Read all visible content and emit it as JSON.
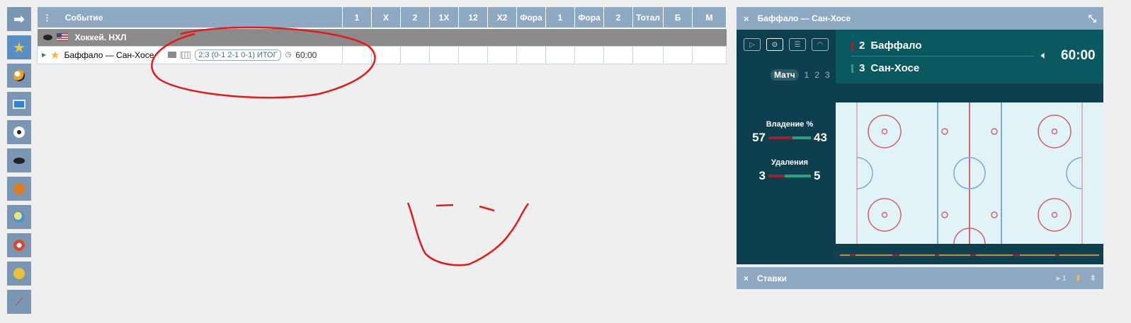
{
  "sidebar": {
    "items": [
      {
        "icon": "arrow-right-icon",
        "active": false
      },
      {
        "icon": "star-icon",
        "active": true
      },
      {
        "icon": "multi-sport-icon",
        "active": false
      },
      {
        "icon": "monitor-icon",
        "active": false
      },
      {
        "icon": "soccer-ball-icon",
        "active": false
      },
      {
        "icon": "hockey-puck-icon",
        "active": false
      },
      {
        "icon": "basketball-icon",
        "active": false
      },
      {
        "icon": "volleyball-icon",
        "active": false
      },
      {
        "icon": "handball-icon",
        "active": false
      },
      {
        "icon": "tennis-ball-icon",
        "active": false
      },
      {
        "icon": "badminton-icon",
        "active": false
      }
    ]
  },
  "events": {
    "header": {
      "menu": "⋮",
      "event": "Событие",
      "columns": [
        "1",
        "X",
        "2",
        "1X",
        "12",
        "X2",
        "Фора",
        "1",
        "Фора",
        "2",
        "Тотал",
        "Б",
        "М"
      ]
    },
    "league": {
      "name": "Хоккей. НХЛ"
    },
    "match": {
      "teams": "Баффало — Сан-Хосе",
      "score": "2:3 (0-1 2-1 0-1) ИТОГ",
      "time": "60:00"
    }
  },
  "widget": {
    "title": "Баффало — Сан-Хосе",
    "close": "×",
    "periods": {
      "match": "Матч",
      "p1": "1",
      "p2": "2",
      "p3": "3"
    },
    "team1": {
      "score": "2",
      "name": "Баффало"
    },
    "team2": {
      "score": "3",
      "name": "Сан-Хосе"
    },
    "clock": "60:00",
    "possession": {
      "label": "Владение %",
      "left": "57",
      "right": "43",
      "left_fraction": 0.57
    },
    "penalties": {
      "label": "Удаления",
      "left": "3",
      "right": "5",
      "left_fraction": 0.375
    },
    "colors": {
      "team1": "#9b2335",
      "team2": "#2aa184"
    }
  },
  "bets_panel": {
    "close": "×",
    "title": "Ставки",
    "count": "1"
  }
}
